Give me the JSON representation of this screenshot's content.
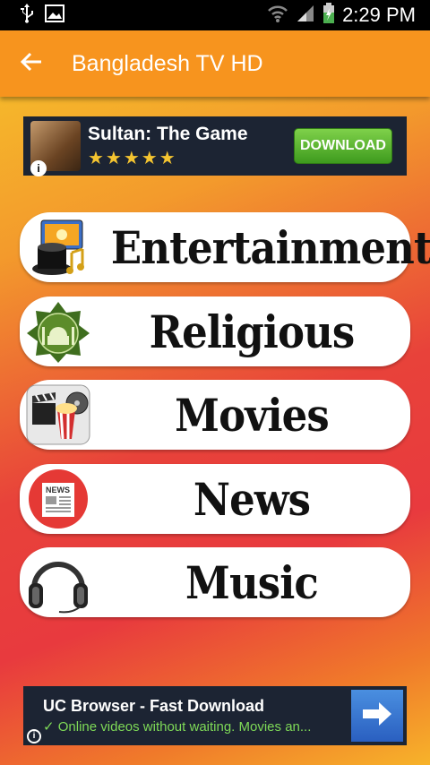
{
  "status_bar": {
    "time": "2:29 PM",
    "icons": [
      "usb-icon",
      "image-icon",
      "wifi-icon",
      "signal-icon",
      "battery-icon"
    ]
  },
  "app_bar": {
    "title": "Bangladesh TV HD",
    "back_icon": "arrow-left-icon"
  },
  "ad_top": {
    "title": "Sultan: The Game",
    "rating": "★★★★★",
    "cta": "DOWNLOAD",
    "info": "i"
  },
  "categories": [
    {
      "label": "Entertainment",
      "icon": "entertainment-icon"
    },
    {
      "label": "Religious",
      "icon": "mosque-icon"
    },
    {
      "label": "Movies",
      "icon": "movies-icon"
    },
    {
      "label": "News",
      "icon": "news-icon"
    },
    {
      "label": "Music",
      "icon": "headphones-icon"
    }
  ],
  "news_icon_text": "NEWS",
  "ad_bottom": {
    "title": "UC Browser - Fast Download",
    "subtitle": "✓ Online videos without waiting. Movies an...",
    "info": "i"
  },
  "colors": {
    "app_bar": "#f7941e",
    "status_bar": "#000000",
    "ad_bg": "#1c2433",
    "download_green": "#3e9b1e"
  }
}
